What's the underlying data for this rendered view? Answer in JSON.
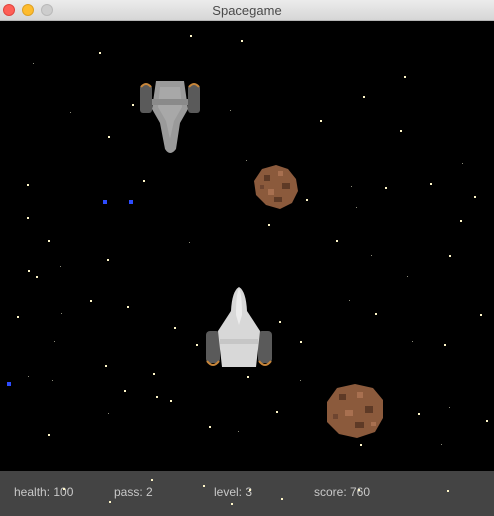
{
  "window": {
    "title": "Spacegame"
  },
  "hud": {
    "health": "health: 100",
    "pass": "pass: 2",
    "level": "level: 3",
    "score": "score: 760"
  },
  "colors": {
    "background": "#000000",
    "statusbar": "#444444",
    "player_ship": "#d8d8d8",
    "enemy_ship": "#9a9a9a",
    "engine_glow": "#c8863a",
    "asteroid": "#8b5a3c",
    "laser": "#2d4cff"
  }
}
